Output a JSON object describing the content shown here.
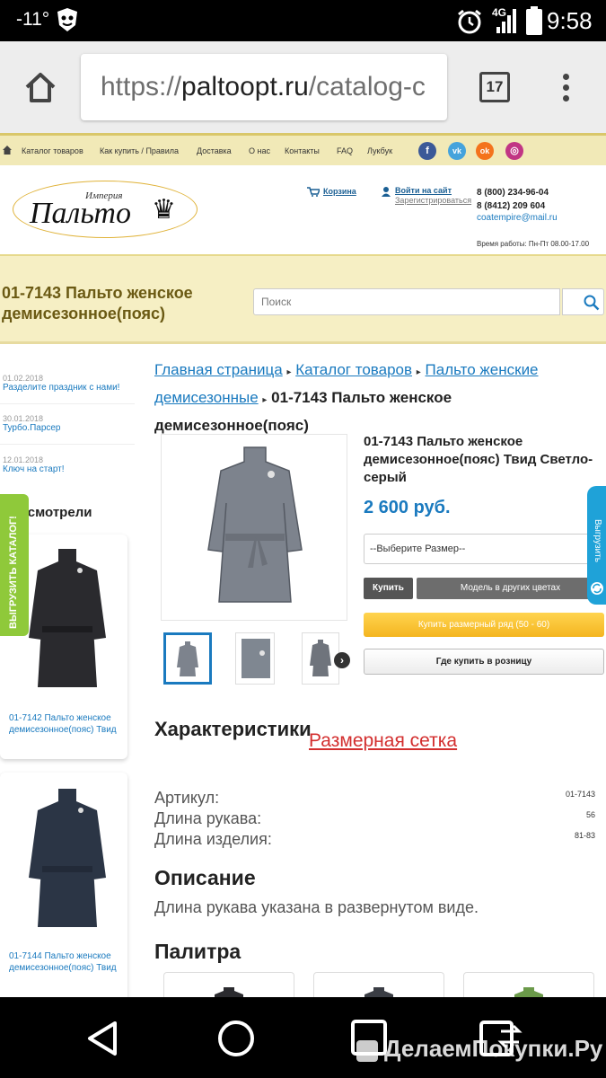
{
  "statusbar": {
    "temperature": "-11°",
    "network": "4G",
    "time": "9:58"
  },
  "browser": {
    "url_prefix": "https://",
    "url_domain": "paltoopt.ru",
    "url_path": "/catalog-c",
    "tab_count": "17"
  },
  "topnav": {
    "items": [
      "Каталог товаров",
      "Как купить / Правила",
      "Доставка",
      "О нас",
      "Контакты",
      "FAQ",
      "Лукбук"
    ],
    "social": [
      {
        "icon": "facebook-icon",
        "glyph": "f",
        "color": "#3b5998"
      },
      {
        "icon": "vk-icon",
        "glyph": "vk",
        "color": "#45a3dc"
      },
      {
        "icon": "odnoklassniki-icon",
        "glyph": "ok",
        "color": "#f4731c"
      },
      {
        "icon": "instagram-icon",
        "glyph": "◎",
        "color": "#c13584"
      }
    ]
  },
  "header": {
    "logo_small": "Империя",
    "logo_big": "Пальто",
    "cart_label": "Корзина",
    "login_label": "Войти на сайт",
    "register_label": "Зарегистрироваться",
    "phone1": "8 (800) 234-96-04",
    "phone2": "8 (8412) 209 604",
    "email": "coatempire@mail.ru",
    "work_hours": "Время работы: Пн-Пт 08.00-17.00"
  },
  "page_title": "01-7143 Пальто женское демисезонное(пояс)",
  "search": {
    "placeholder": "Поиск"
  },
  "sidebar": {
    "news": [
      {
        "date": "01.02.2018",
        "title": "Разделите праздник с нами!"
      },
      {
        "date": "30.01.2018",
        "title": "Турбо.Парсер"
      },
      {
        "date": "12.01.2018",
        "title": "Ключ на старт!"
      }
    ],
    "viewed_heading": "Вы смотрели",
    "viewed": [
      {
        "caption": "01-7142 Пальто женское демисезонное(пояс) Твид"
      },
      {
        "caption": "01-7144 Пальто женское демисезонное(пояс) Твид"
      }
    ],
    "export_tab": "ВЫГРУЗИТЬ КАТАЛОГ!"
  },
  "breadcrumb": {
    "items": [
      "Главная страница",
      "Каталог товаров",
      "Пальто женские демисезонные"
    ],
    "current": "01-7143 Пальто женское демисезонное(пояс)"
  },
  "product": {
    "name": "01-7143 Пальто женское демисезонное(пояс) Твид Светло-серый",
    "price": "2 600 руб.",
    "size_select": "--Выберите Размер--",
    "buy_label": "Купить",
    "colors_label": "Модель в других цветах",
    "size_row_label": "Купить размерный ряд (50 - 60)",
    "retail_label": "Где купить в розницу",
    "next_arrow": "›"
  },
  "characteristics": {
    "heading": "Характеристики",
    "size_chart_link": "Размерная сетка",
    "rows": [
      {
        "label": "Артикул:",
        "value": "01-7143"
      },
      {
        "label": "Длина рукава:",
        "value": "56"
      },
      {
        "label": "Длина изделия:",
        "value": "81-83"
      }
    ]
  },
  "description": {
    "heading": "Описание",
    "text": "Длина рукава указана в развернутом виде."
  },
  "palette": {
    "heading": "Палитра"
  },
  "exchange_tab": "Выгрузить",
  "watermark": "ДелаемПокупки.Ру"
}
